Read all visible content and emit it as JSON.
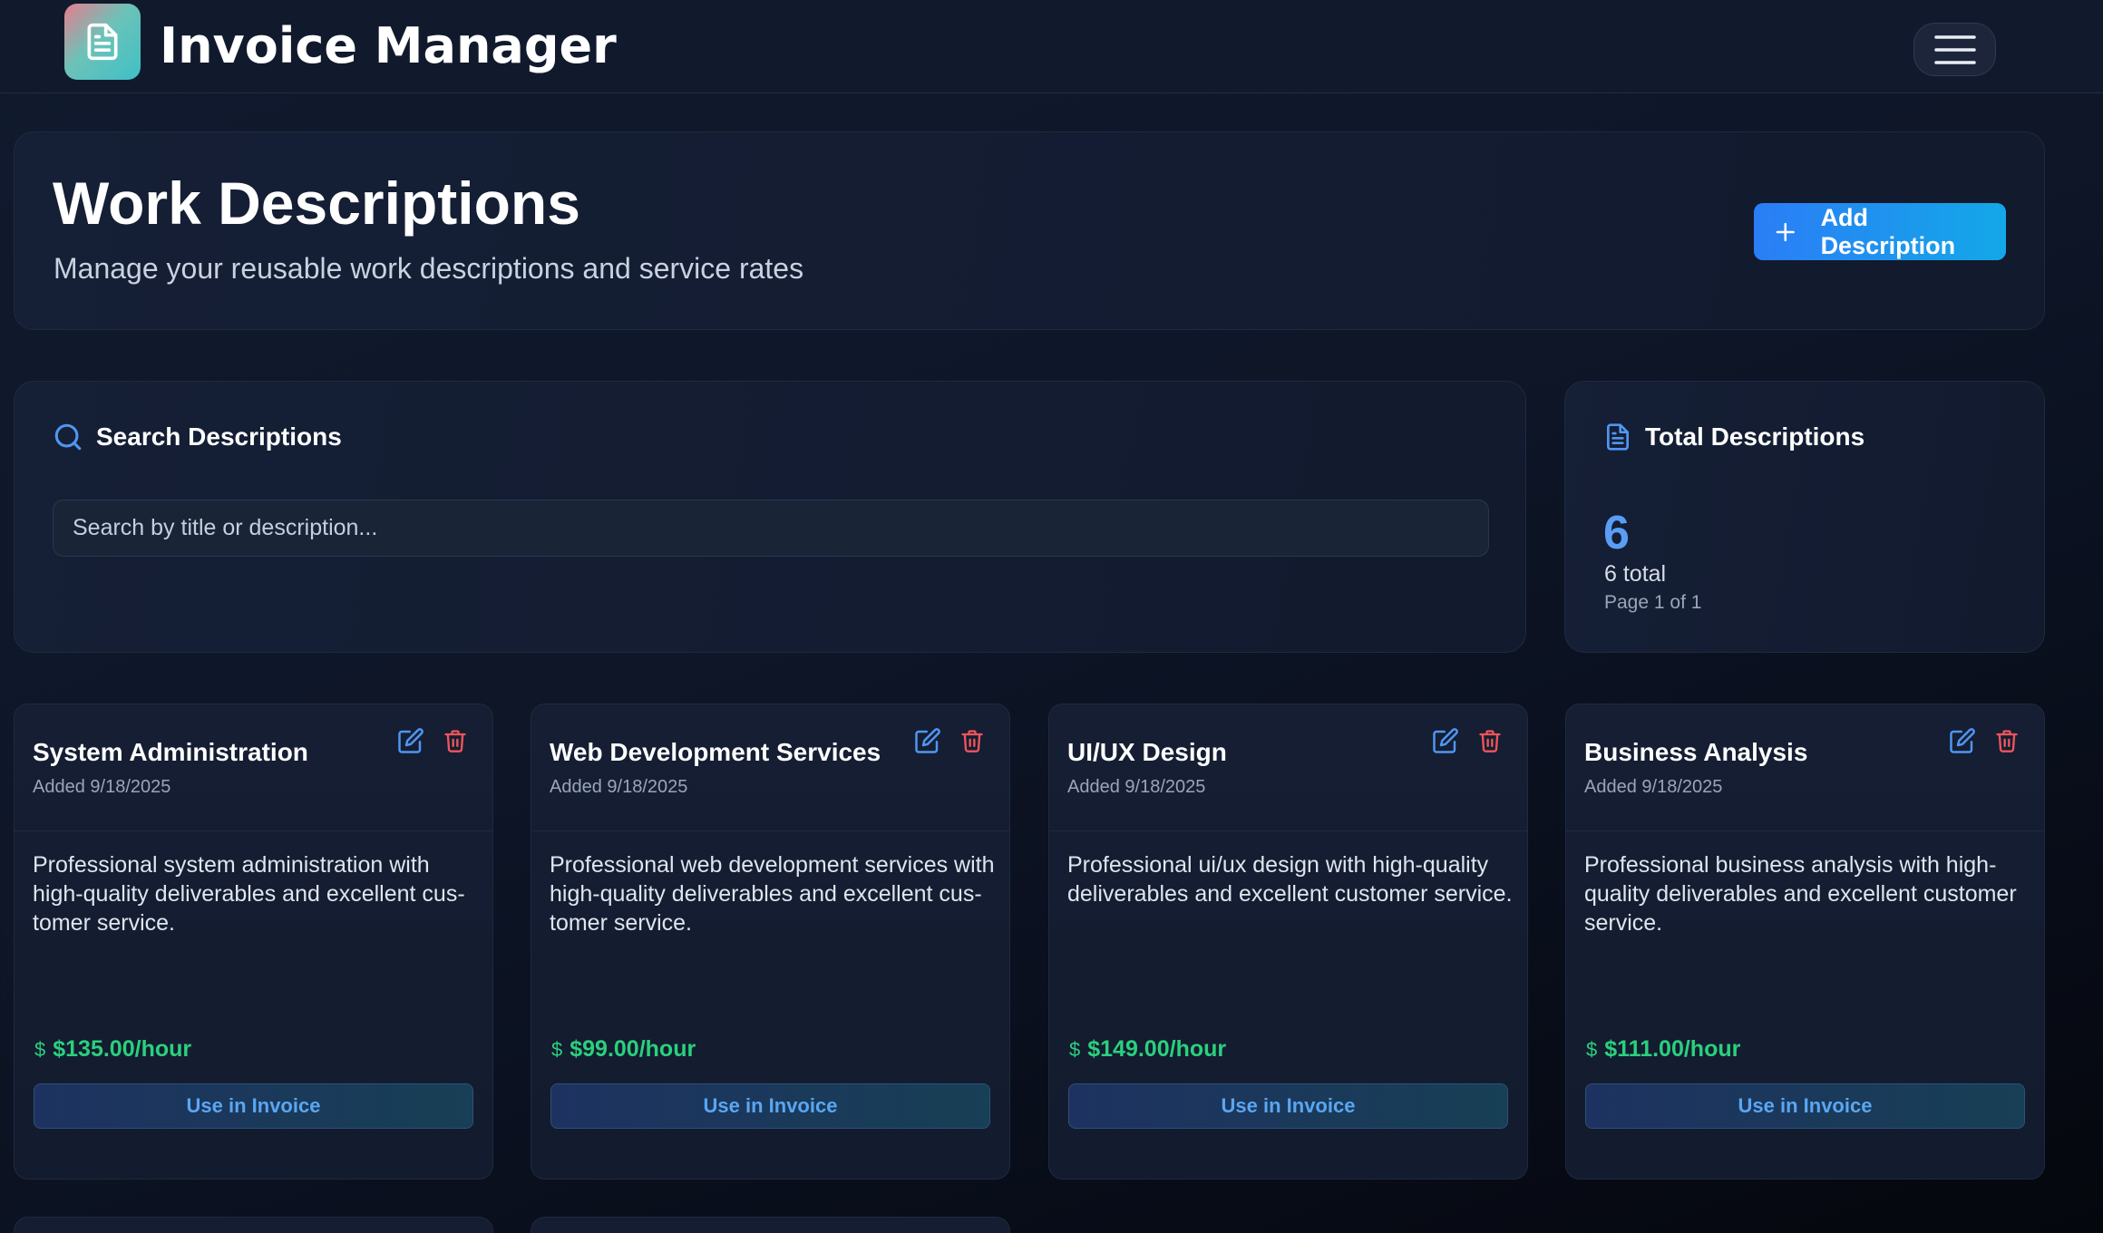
{
  "app": {
    "title": "Invoice Manager",
    "logo_icon": "document-icon",
    "menu_icon": "hamburger-menu-icon"
  },
  "hero": {
    "title": "Work Descriptions",
    "subtitle": "Manage your reusable work descriptions and service rates",
    "add_button_label": "Add Description",
    "add_button_icon": "plus-icon"
  },
  "search": {
    "heading": "Search Descriptions",
    "placeholder": "Search by title or description...",
    "value": ""
  },
  "totals": {
    "heading": "Total Descriptions",
    "count": "6",
    "total_text": "6 total",
    "page_text": "Page 1 of 1"
  },
  "descriptions": [
    {
      "title": "System Administration",
      "added": "Added 9/18/2025",
      "body": "Professional system administration with high-quality deliverables and excellent cus- tomer service.",
      "rate": "$135.00/hour",
      "button": "Use in Invoice"
    },
    {
      "title": "Web Development Services",
      "added": "Added 9/18/2025",
      "body": "Professional web development services with high-quality deliverables and excellent cus- tomer service.",
      "rate": "$99.00/hour",
      "button": "Use in Invoice"
    },
    {
      "title": "UI/UX Design",
      "added": "Added 9/18/2025",
      "body": "Professional ui/ux design with high-quality deliverables and excellent customer service.",
      "rate": "$149.00/hour",
      "button": "Use in Invoice"
    },
    {
      "title": "Business Analysis",
      "added": "Added 9/18/2025",
      "body": "Professional business analysis with high-quality deliverables and excellent customer service.",
      "rate": "$111.00/hour",
      "button": "Use in Invoice"
    }
  ],
  "colors": {
    "accent": "#2b7df6",
    "rate_green": "#2ad07e",
    "delete_red": "#f0555b",
    "edit_blue": "#4f96f2"
  }
}
